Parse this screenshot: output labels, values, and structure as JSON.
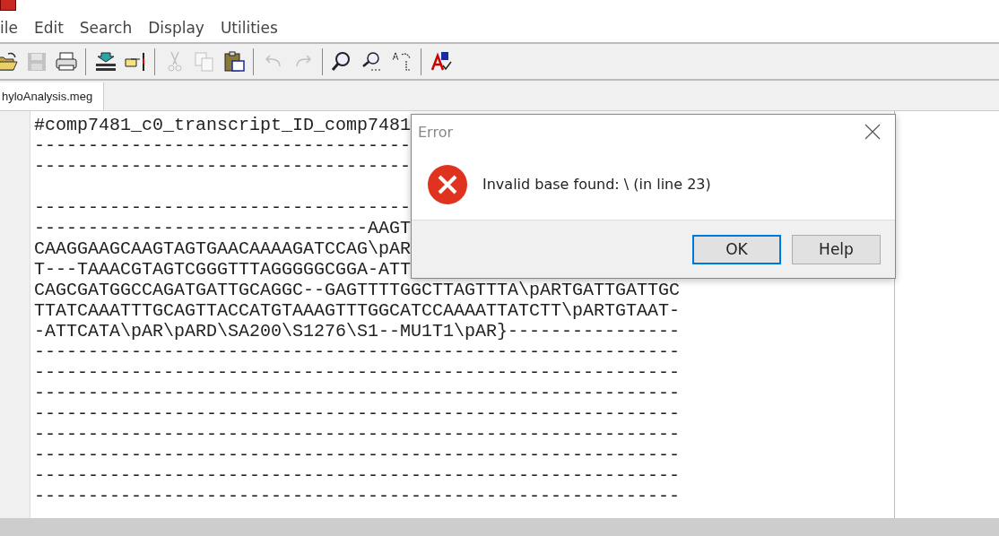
{
  "menu": [
    {
      "label": "ile"
    },
    {
      "label": "Edit"
    },
    {
      "label": "Search"
    },
    {
      "label": "Display"
    },
    {
      "label": "Utilities"
    }
  ],
  "toolbar": [
    {
      "kind": "open",
      "disabled": false
    },
    {
      "kind": "save",
      "disabled": true
    },
    {
      "kind": "print",
      "disabled": false
    },
    {
      "kind": "sep"
    },
    {
      "kind": "align",
      "disabled": false
    },
    {
      "kind": "point",
      "disabled": false
    },
    {
      "kind": "sep"
    },
    {
      "kind": "cut",
      "disabled": true
    },
    {
      "kind": "copy",
      "disabled": true
    },
    {
      "kind": "paste",
      "disabled": false
    },
    {
      "kind": "sep"
    },
    {
      "kind": "undo",
      "disabled": true
    },
    {
      "kind": "redo",
      "disabled": true
    },
    {
      "kind": "sep"
    },
    {
      "kind": "find",
      "disabled": false
    },
    {
      "kind": "findnext",
      "disabled": false
    },
    {
      "kind": "replace",
      "disabled": false
    },
    {
      "kind": "sep"
    },
    {
      "kind": "spell",
      "disabled": false
    }
  ],
  "tabs": [
    {
      "label": "hyloAnalysis.meg",
      "selected": true
    }
  ],
  "editor": {
    "lines": [
      {
        "kind": "text",
        "text": "#comp7481_c0_transcript_ID_comp7481"
      },
      {
        "kind": "text",
        "text": "-----------------------------------"
      },
      {
        "kind": "text",
        "text": "-----------------------------------"
      },
      {
        "kind": "blank"
      },
      {
        "kind": "text",
        "text": "-----------------------------------"
      },
      {
        "kind": "text",
        "text": "-------------------------------AAGT"
      },
      {
        "kind": "text",
        "text": "CAAGGAAGCAAGTAGTGAACAAAAGATCCAG\\pAR"
      },
      {
        "kind": "text",
        "text": "T---TAAACGTAGTCGGGTTTAGGGGGCGGA-ATT"
      },
      {
        "kind": "text",
        "text": "CAGCGATGGCCAGATGATTGCAGGC--GAGTTTTGGCTTAGTTTA\\pARTGATTGATTGC"
      },
      {
        "kind": "text",
        "text": "TTATCAAATTTGCAGTTACCATGTAAAGTTTGGCATCCAAAATTATCTT\\pARTGTAAT-"
      },
      {
        "kind": "text",
        "text": "-ATTCATA\\pAR\\pARD\\SA200\\S1276\\S1--MU1T1\\pAR}----------------"
      },
      {
        "kind": "text",
        "text": "------------------------------------------------------------"
      },
      {
        "kind": "text",
        "text": "------------------------------------------------------------"
      },
      {
        "kind": "text",
        "text": "------------------------------------------------------------"
      },
      {
        "kind": "text",
        "text": "------------------------------------------------------------"
      },
      {
        "kind": "text",
        "text": "------------------------------------------------------------"
      },
      {
        "kind": "text",
        "text": "------------------------------------------------------------"
      },
      {
        "kind": "text",
        "text": "------------------------------------------------------------"
      },
      {
        "kind": "text",
        "text": "------------------------------------------------------------"
      }
    ]
  },
  "dialog": {
    "title": "Error",
    "message": "Invalid base found: \\ (in line 23)",
    "buttons": [
      {
        "label": "OK",
        "default": true
      },
      {
        "label": "Help",
        "default": false
      }
    ]
  }
}
